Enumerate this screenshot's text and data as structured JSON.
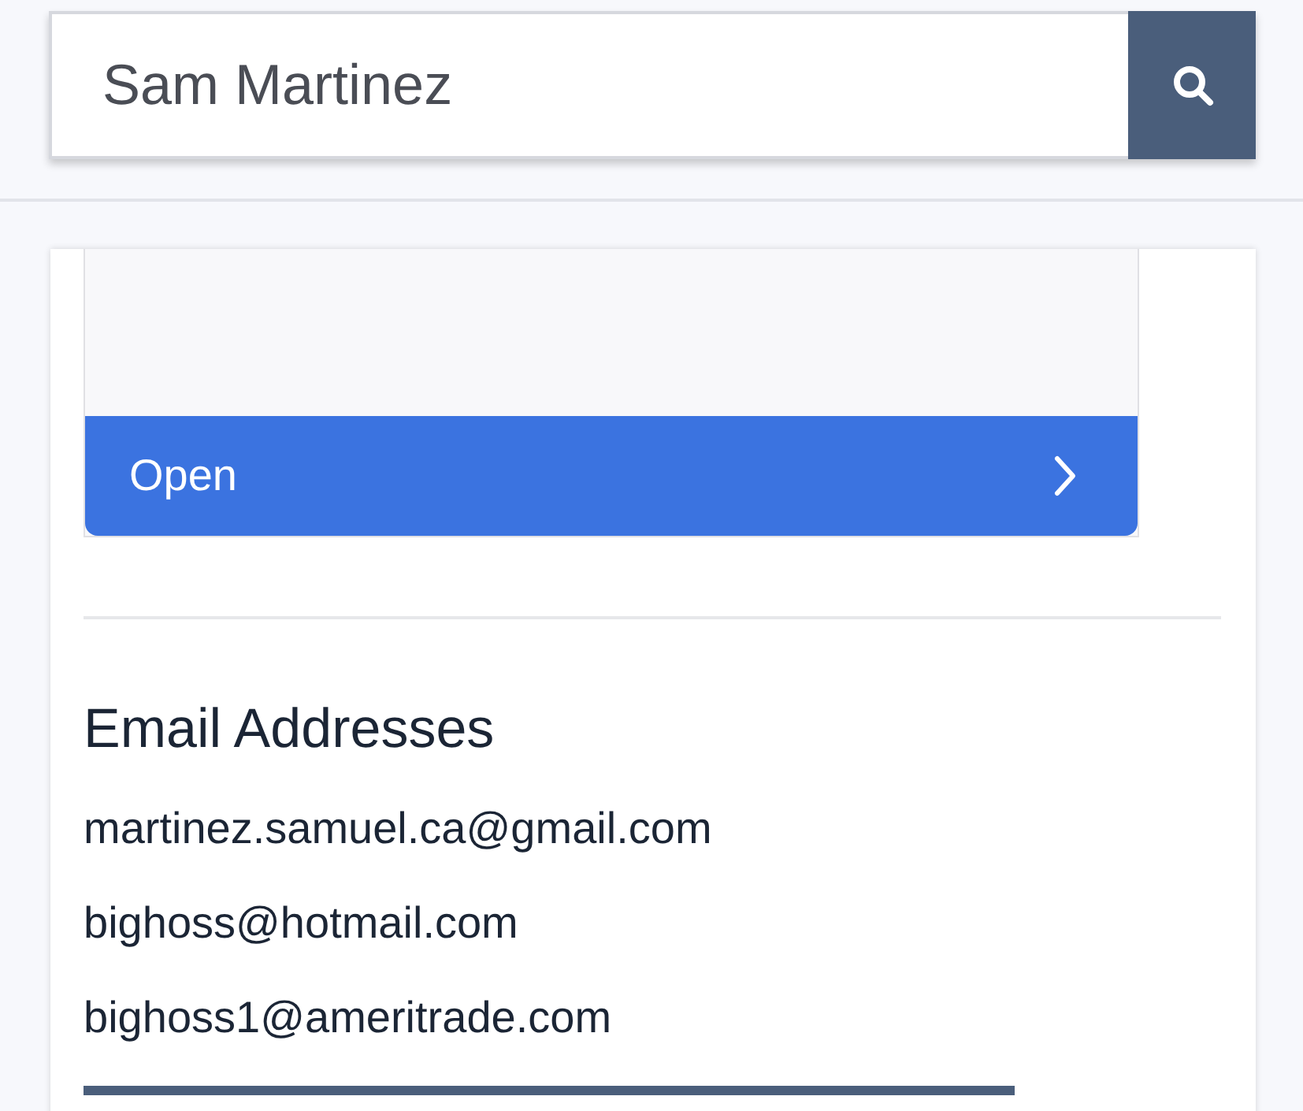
{
  "search": {
    "value": "Sam Martinez"
  },
  "preview_card": {
    "open_button": {
      "label": "Open"
    }
  },
  "email_section": {
    "title": "Email Addresses",
    "emails": [
      "martinez.samuel.ca@gmail.com",
      "bighoss@hotmail.com",
      "bighoss1@ameritrade.com"
    ]
  }
}
